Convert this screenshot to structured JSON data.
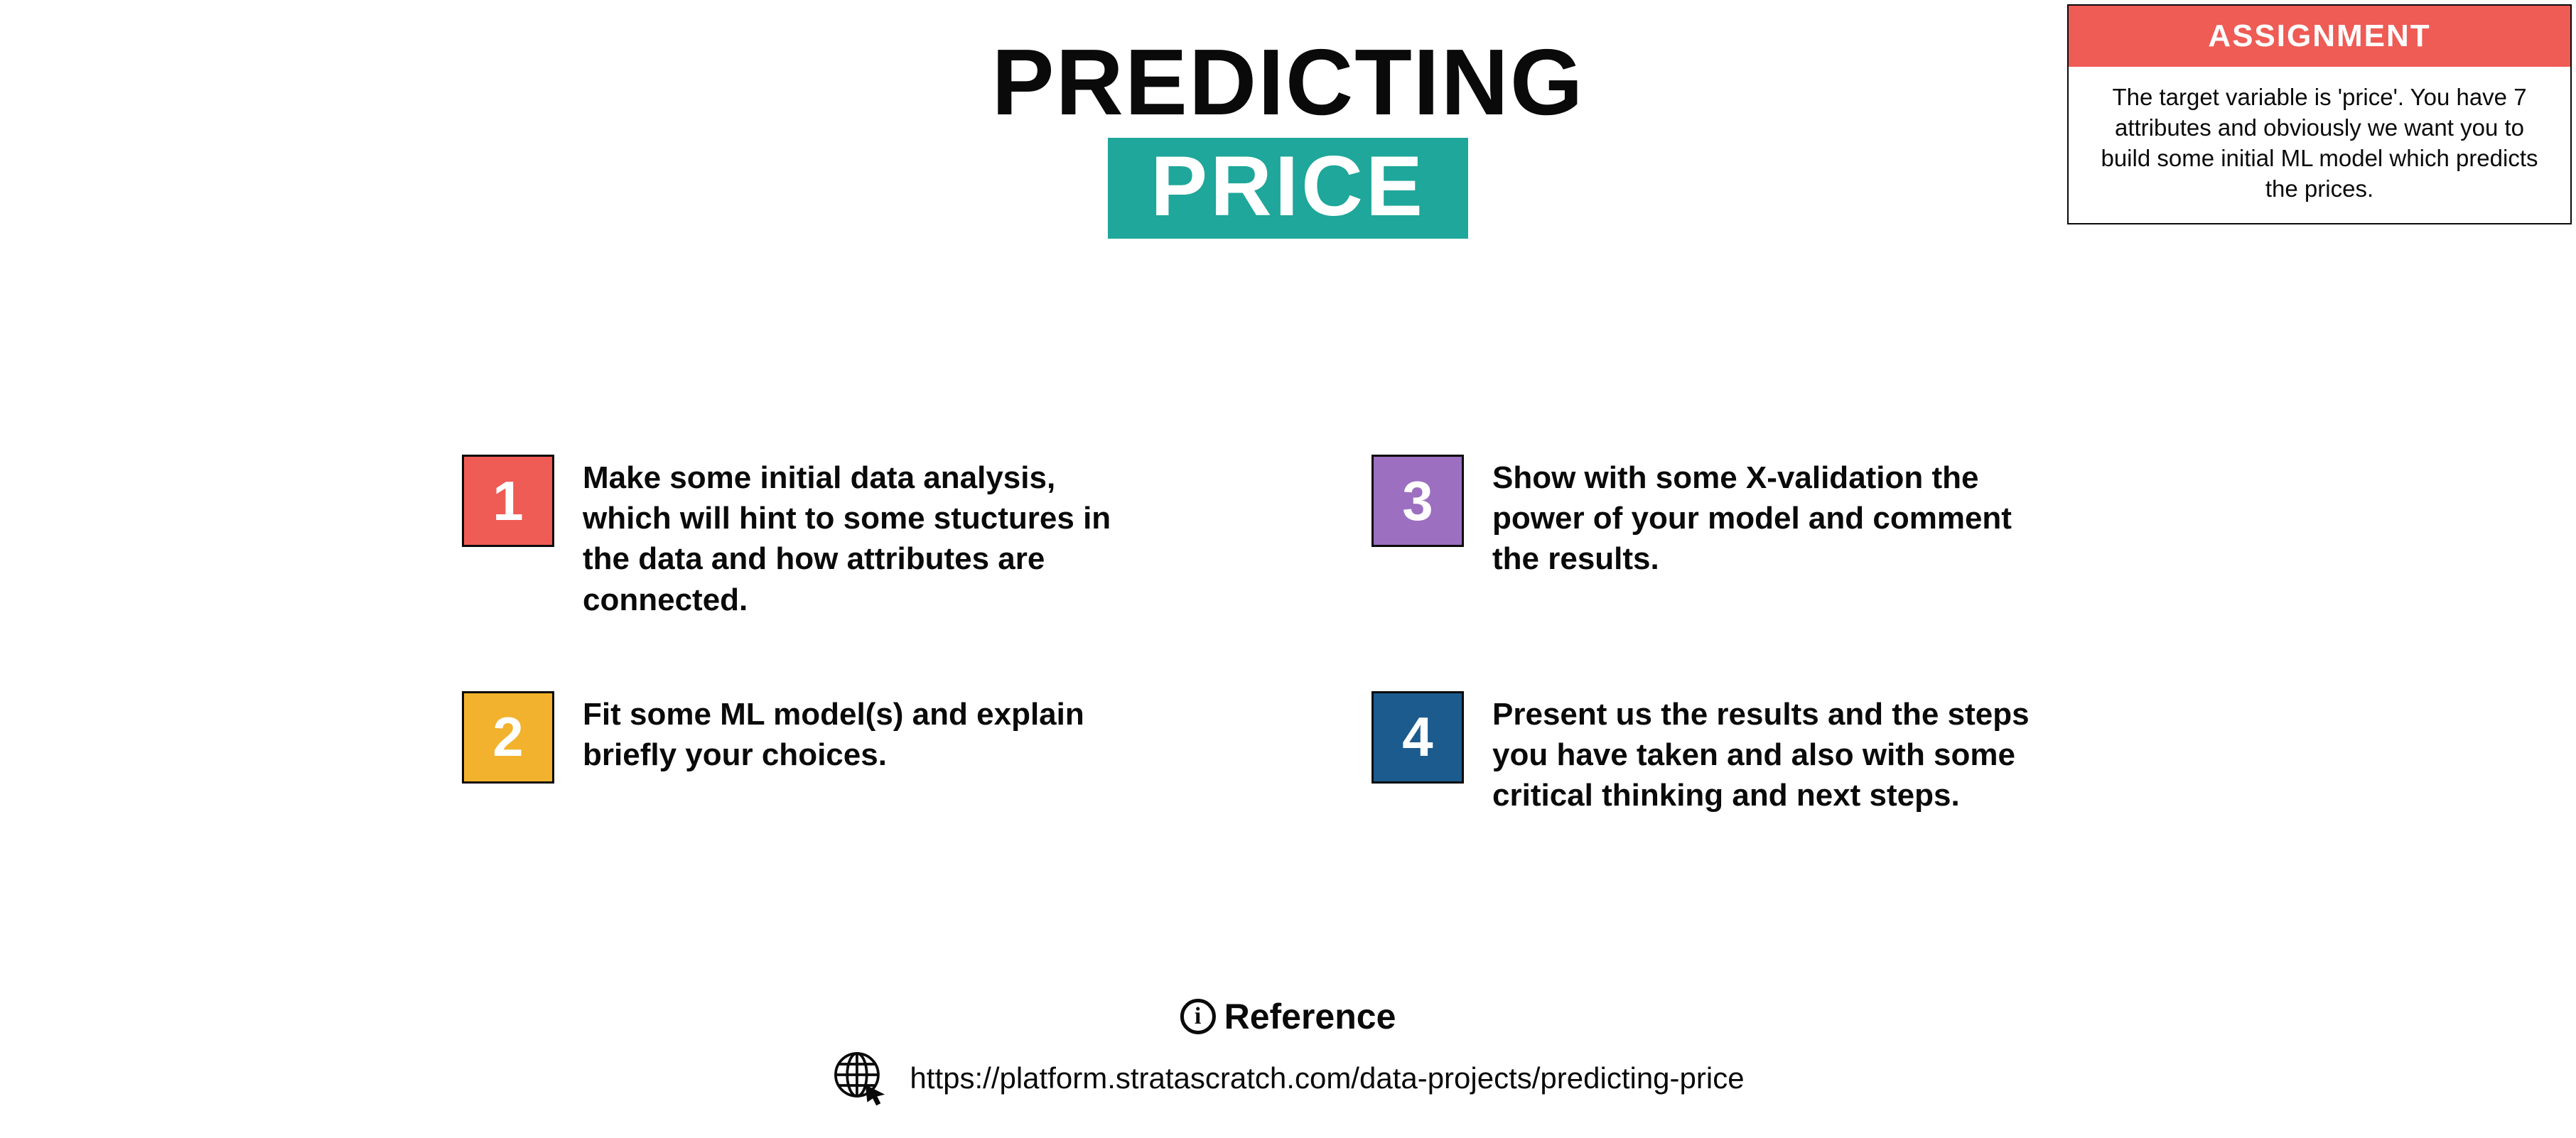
{
  "title": {
    "line1": "PREDICTING",
    "line2": "PRICE"
  },
  "assignment": {
    "header": "ASSIGNMENT",
    "body": "The target variable is 'price'. You have 7 attributes and obviously we want you to build some initial ML model which predicts the prices."
  },
  "steps": [
    {
      "num": "1",
      "text": "Make some initial data analysis, which will hint to some stuctures in the data and how attributes are connected.",
      "color": "red"
    },
    {
      "num": "2",
      "text": "Fit some ML model(s) and explain briefly your choices.",
      "color": "yellow"
    },
    {
      "num": "3",
      "text": "Show with some X-validation the power of your model and comment the results.",
      "color": "purple"
    },
    {
      "num": "4",
      "text": "Present us the results and the steps you have taken and also with some critical thinking and next steps.",
      "color": "blue"
    }
  ],
  "reference": {
    "heading": "Reference",
    "url": "https://platform.stratascratch.com/data-projects/predicting-price"
  },
  "colors": {
    "teal": "#1ea79a",
    "red": "#ef5b55",
    "yellow": "#f2b22d",
    "purple": "#9c6fc0",
    "blue": "#1c5b8e"
  }
}
